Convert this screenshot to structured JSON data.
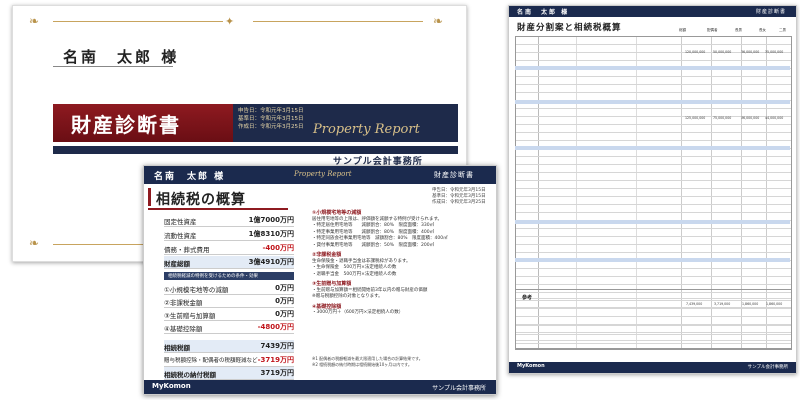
{
  "cover": {
    "name": "名南　太郎 様",
    "title": "財産診断書",
    "meta_lines": [
      "申告日：令和元年3月15日",
      "基準日：令和元年3月15日",
      "作成日：令和元年3月25日"
    ],
    "subtitle": "Property Report",
    "office": "サンプル会計事務所"
  },
  "summary": {
    "header_name": "名南　太郎 様",
    "header_subtitle": "Property Report",
    "header_title": "財産診断書",
    "section_title": "相続税の概算",
    "dates": [
      "申告日：令和元年3月15日",
      "基準日：令和元年3月15日",
      "作成日：令和元年3月25日"
    ],
    "rows": [
      {
        "label": "固定性資産",
        "value": "1億7000万円"
      },
      {
        "label": "流動性資産",
        "value": "1億8310万円"
      },
      {
        "label": "債務・葬式費用",
        "value": "-400万円"
      },
      {
        "label": "財産総額",
        "value": "3億4910万円"
      }
    ],
    "sub_header": "相続税軽減の特例を受けるための条件・効果",
    "deductions": [
      {
        "label": "①小規模宅地等の減額",
        "value": "0万円"
      },
      {
        "label": "②非課税金額",
        "value": "0万円"
      },
      {
        "label": "③生前贈与加算額",
        "value": "0万円"
      },
      {
        "label": "④基礎控除額",
        "value": "-4800万円"
      }
    ],
    "totals": [
      {
        "label": "相続税額",
        "value": "7439万円"
      },
      {
        "label": "贈与税額控除・配偶者の税額軽減など",
        "value": "-3719万円"
      },
      {
        "label": "相続税の納付税額",
        "value": "3719万円"
      }
    ],
    "right_col": {
      "h1": "①小規模宅地等の減額",
      "l1": [
        "居住用宅地等の上限は、評価額を減額する特例が受けられます。",
        "・特定居住用宅地等　　減額割合：80%　限度面積：330㎡",
        "・特定事業用宅地等　　減額割合：80%　限度面積：400㎡",
        "・特定同族会社事業用宅地等　減額割合：80%　限度面積：400㎡",
        "・貸付事業用宅地等　　減額割合：50%　限度面積：200㎡"
      ],
      "h2": "②非課税金額",
      "l2": [
        "生命保険金・退職手当金は非課税枠があります。",
        "・生命保険金　500万円×法定相続人の数",
        "・退職手当金　500万円×法定相続人の数"
      ],
      "h3": "③生前贈与加算額",
      "l3": [
        "・生前贈与加算額＝相続開始前3年以内の贈与財産の価額",
        "※贈与税額控除の対象となります。"
      ],
      "h4": "④基礎控除額",
      "l4": [
        "・3000万円＋（600万円×法定相続人の数）"
      ]
    },
    "note": [
      "※1 配偶者の税額軽減を最大限適用した場合の計算結果です。",
      "※2 相続税額の納付時期は相続開始後10ヶ月以内です。"
    ],
    "footer_logo": "MyKomon",
    "footer_office": "サンプル会計事務所"
  },
  "table": {
    "header_name": "名南　太郎 様",
    "header_title": "財産診断書",
    "title": "財産分割案と相続税概算",
    "col_heads": [
      "総額",
      "配偶者",
      "長男",
      "長女",
      "二男"
    ],
    "summary_label": "参考",
    "values": [
      "120,000,000",
      "50,000,000",
      "36,000,000",
      "35,000,000",
      "125,000,000",
      "75,000,000",
      "36,000,000",
      "44,000,000",
      "7,439,000",
      "3,719,000",
      "1,860,000",
      "1,860,000"
    ],
    "footer_logo": "MyKomon",
    "footer_office": "サンプル会計事務所"
  }
}
